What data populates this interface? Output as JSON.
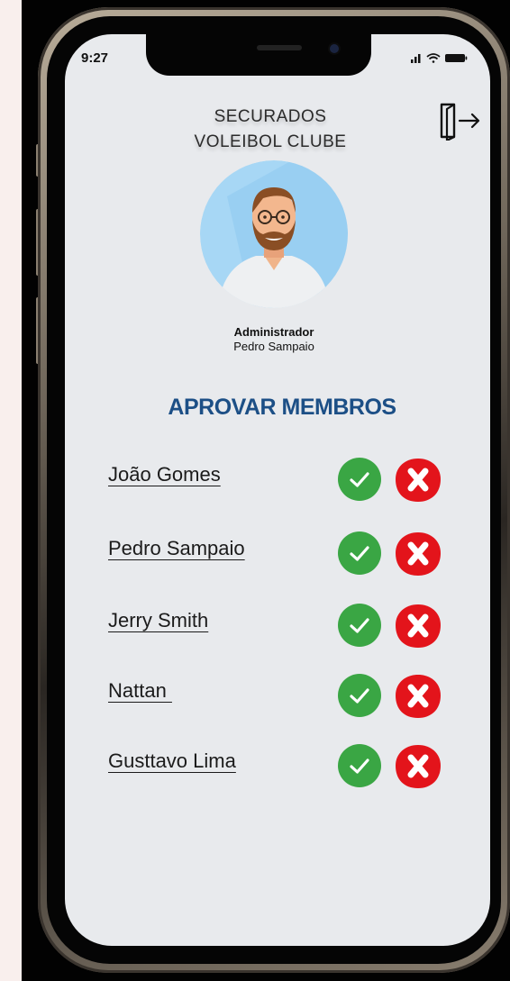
{
  "status_bar": {
    "time": "9:27",
    "icons": [
      "signal-icon",
      "wifi-icon",
      "battery-icon"
    ]
  },
  "header": {
    "title_line1": "SECURADOS",
    "title_line2": "VOLEIBOL CLUBE",
    "logout_icon": "logout-door-icon"
  },
  "profile": {
    "role": "Administrador",
    "name": "Pedro Sampaio",
    "avatar_icon": "bearded-man-avatar"
  },
  "section": {
    "title": "APROVAR MEMBROS"
  },
  "members": [
    {
      "name": "João Gomes"
    },
    {
      "name": "Pedro Sampaio"
    },
    {
      "name": "Jerry Smith"
    },
    {
      "name": "Nattan "
    },
    {
      "name": "Gusttavo Lima"
    }
  ],
  "actions": {
    "approve_icon": "check-icon",
    "reject_icon": "x-icon"
  },
  "colors": {
    "page_bg": "#f9efed",
    "screen_bg": "#e8eaed",
    "section_title": "#1c4f86",
    "approve": "#3aa644",
    "reject": "#e3141b"
  }
}
